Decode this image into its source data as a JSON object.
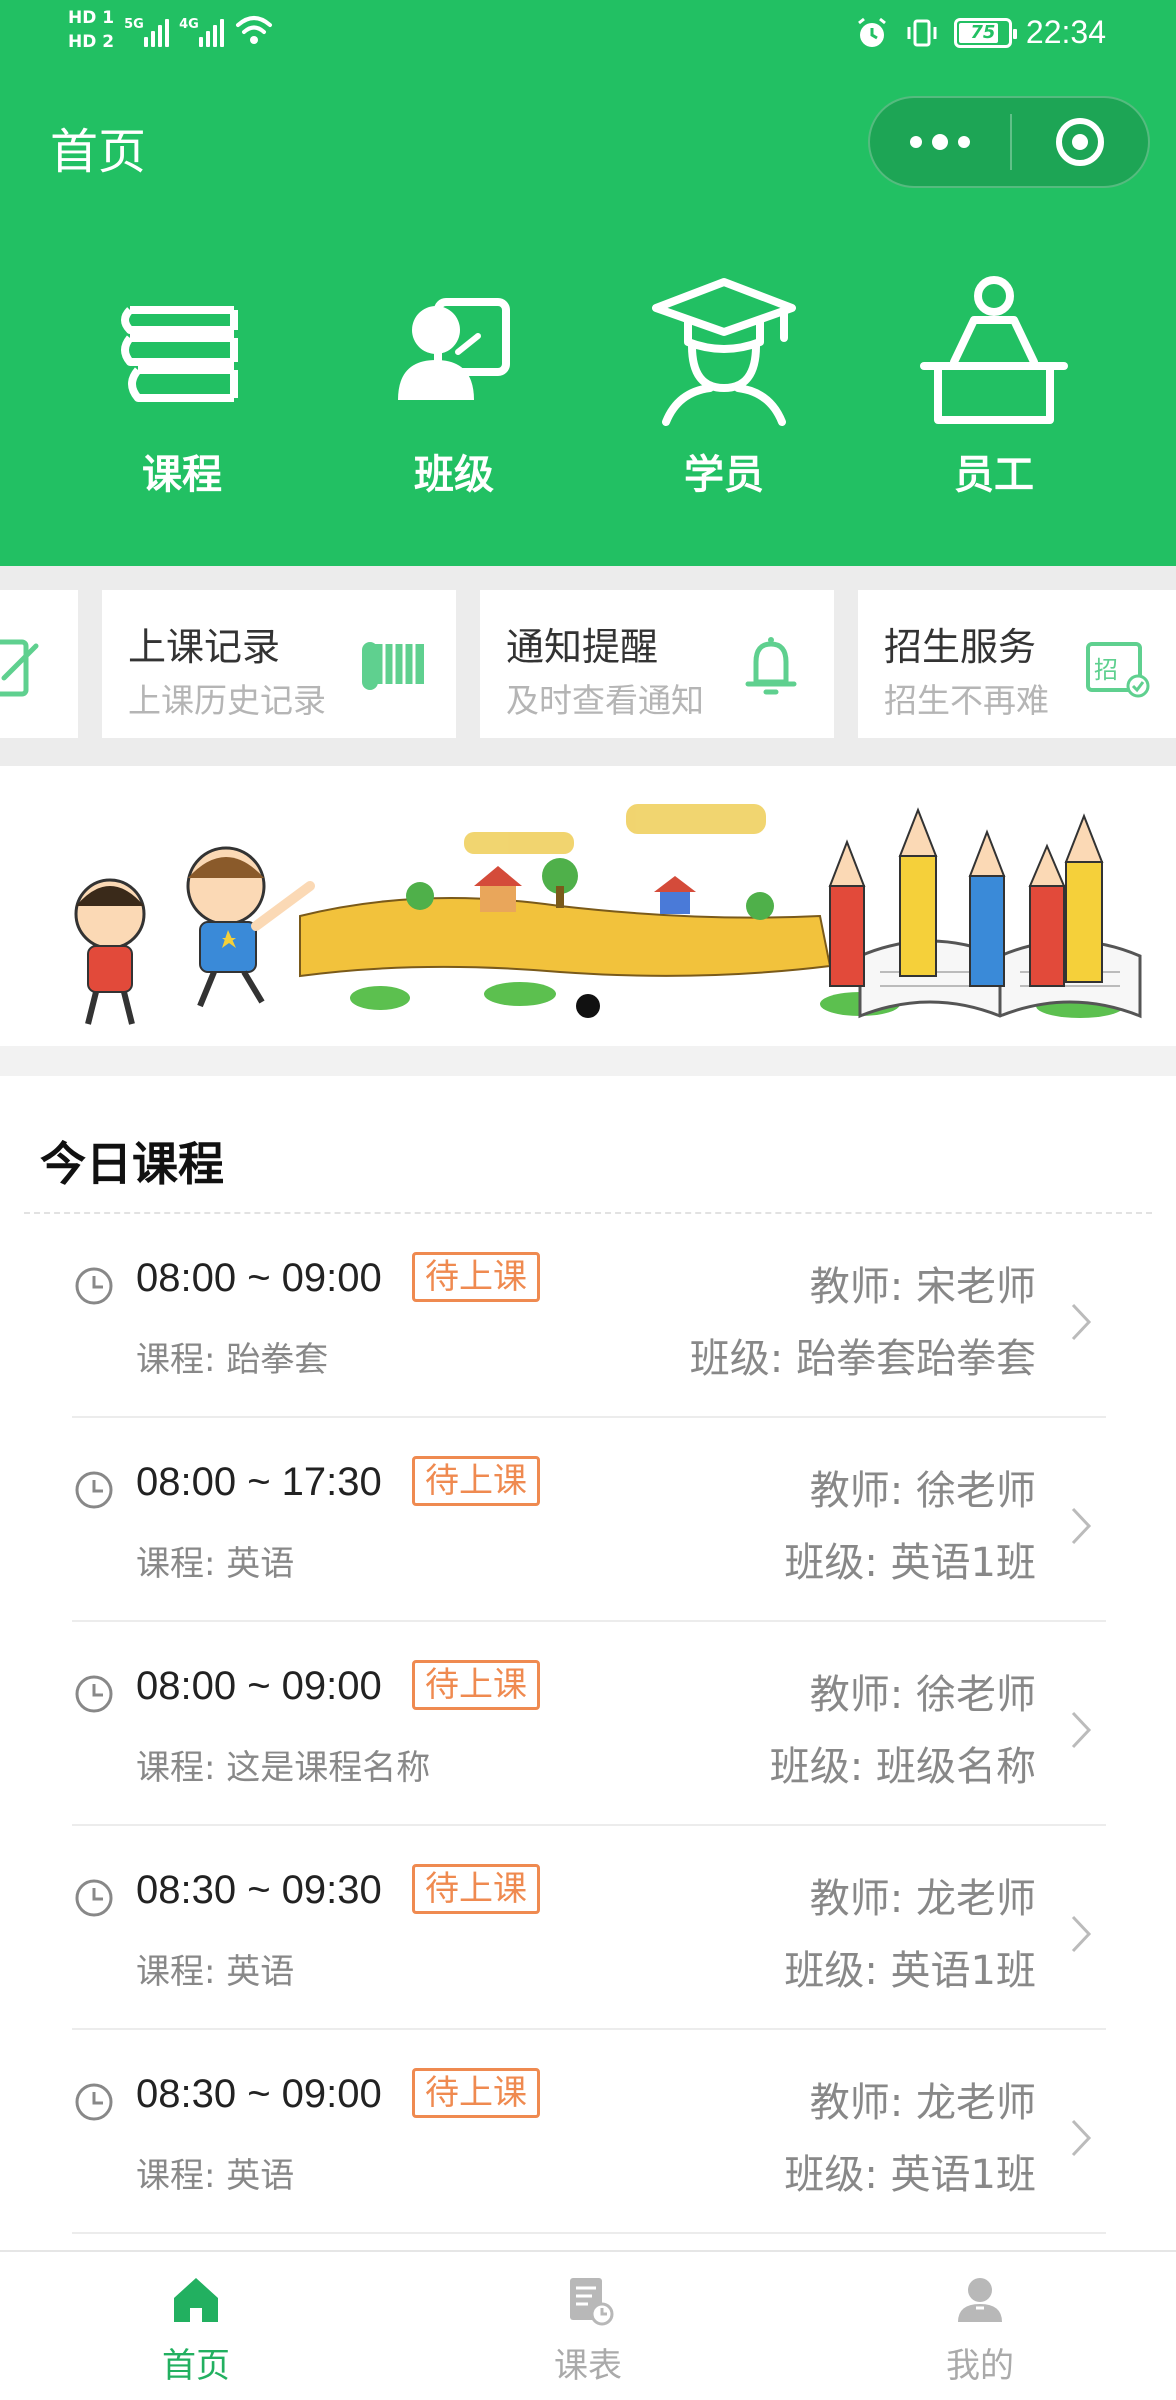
{
  "status_bar": {
    "hd1": "HD 1",
    "hd2": "HD 2",
    "net1": "5G",
    "net2": "4G",
    "battery": "75",
    "time": "22:34"
  },
  "header": {
    "title": "首页"
  },
  "nav": {
    "items": [
      {
        "label": "课程",
        "icon": "book-stack-icon"
      },
      {
        "label": "班级",
        "icon": "class-board-icon"
      },
      {
        "label": "学员",
        "icon": "graduate-cap-icon"
      },
      {
        "label": "员工",
        "icon": "staff-desk-icon"
      }
    ]
  },
  "quick_cards": [
    {
      "title": "上课记录",
      "subtitle": "上课历史记录",
      "icon": "record-icon"
    },
    {
      "title": "通知提醒",
      "subtitle": "及时查看通知",
      "icon": "bell-icon"
    },
    {
      "title": "招生服务",
      "subtitle": "招生不再难",
      "icon": "enroll-icon"
    }
  ],
  "banner": {
    "active_index": 0
  },
  "today": {
    "title": "今日课程",
    "courses": [
      {
        "time": "08:00 ~ 09:00",
        "status": "待上课",
        "course": "课程: 跆拳套",
        "teacher": "教师: 宋老师",
        "class": "班级: 跆拳套跆拳套"
      },
      {
        "time": "08:00 ~ 17:30",
        "status": "待上课",
        "course": "课程: 英语",
        "teacher": "教师: 徐老师",
        "class": "班级: 英语1班"
      },
      {
        "time": "08:00 ~ 09:00",
        "status": "待上课",
        "course": "课程: 这是课程名称",
        "teacher": "教师: 徐老师",
        "class": "班级: 班级名称"
      },
      {
        "time": "08:30 ~ 09:30",
        "status": "待上课",
        "course": "课程: 英语",
        "teacher": "教师: 龙老师",
        "class": "班级: 英语1班"
      },
      {
        "time": "08:30 ~ 09:00",
        "status": "待上课",
        "course": "课程: 英语",
        "teacher": "教师: 龙老师",
        "class": "班级: 英语1班"
      }
    ]
  },
  "tab_bar": {
    "items": [
      {
        "label": "首页",
        "icon": "home-icon",
        "active": true
      },
      {
        "label": "课表",
        "icon": "schedule-icon",
        "active": false
      },
      {
        "label": "我的",
        "icon": "profile-icon",
        "active": false
      }
    ]
  },
  "colors": {
    "primary": "#22c063",
    "status_pending": "#ef8a50",
    "tab_active": "#22b060"
  }
}
